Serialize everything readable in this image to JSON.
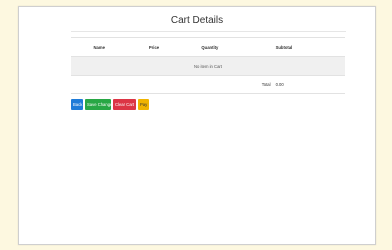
{
  "page": {
    "title": "Cart Details"
  },
  "table": {
    "headers": [
      "",
      "Name",
      "Price",
      "Quantity",
      "Subtotal"
    ],
    "empty_message": "No item in Cart",
    "total_label": "Total",
    "total_value": "0.00"
  },
  "buttons": {
    "back": "Back",
    "save": "Save Changes",
    "clear": "Clear Cart",
    "pay": "Pay"
  },
  "colors": {
    "background": "#fdf8e0",
    "back_button": "#1e7bd8",
    "save_button": "#28a745",
    "clear_button": "#dc3545",
    "pay_button": "#f0b400"
  }
}
